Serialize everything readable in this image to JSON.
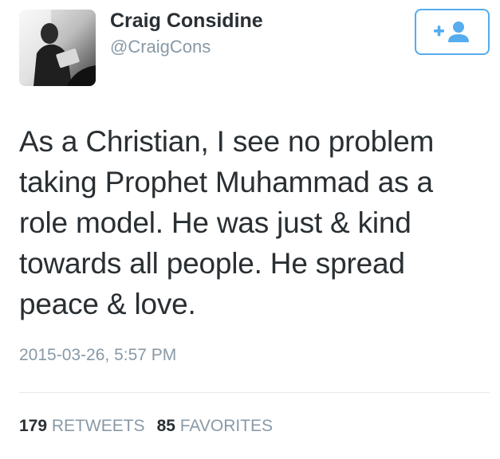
{
  "user": {
    "display_name": "Craig Considine",
    "handle": "@CraigCons",
    "avatar_icon": "profile-photo"
  },
  "follow_button": {
    "icon": "follow-user-icon",
    "color": "#55acee"
  },
  "tweet": {
    "lines": [
      "As a Christian, I see no problem",
      "taking Prophet Muhammad as a",
      "role model. He was just & kind",
      "towards all people. He spread",
      "peace & love."
    ],
    "timestamp": "2015-03-26, 5:57 PM"
  },
  "stats": {
    "retweets_count": "179",
    "retweets_label": "RETWEETS",
    "favorites_count": "85",
    "favorites_label": "FAVORITES"
  },
  "colors": {
    "text": "#292f33",
    "muted": "#8899a6",
    "accent": "#55acee",
    "divider": "#e1e8ed"
  }
}
